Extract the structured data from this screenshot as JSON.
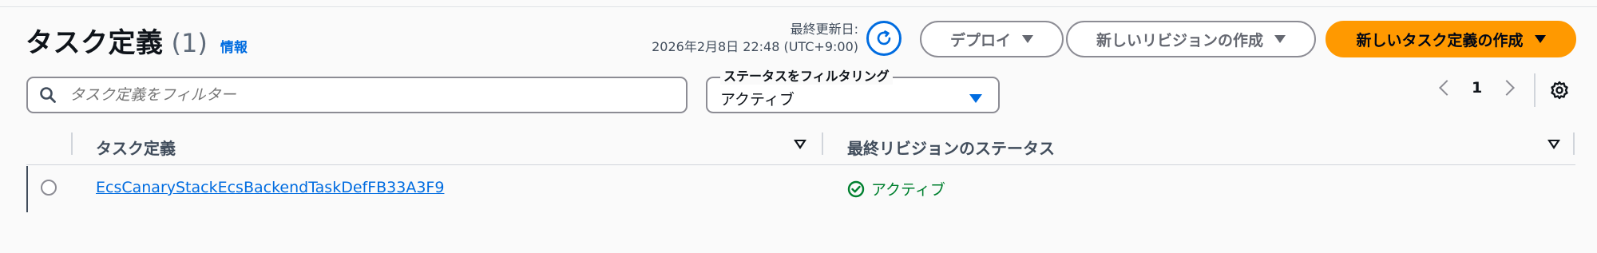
{
  "header": {
    "title": "タスク定義",
    "count": "(1)",
    "info_link": "情報",
    "last_updated_label": "最終更新日:",
    "last_updated_value": "2026年2月8日 22:48 (UTC+9:00)"
  },
  "actions": {
    "deploy_label": "デプロイ",
    "create_revision_label": "新しいリビジョンの作成",
    "create_task_definition_label": "新しいタスク定義の作成"
  },
  "filter": {
    "search_placeholder": "タスク定義をフィルター",
    "status_filter_label": "ステータスをフィルタリング",
    "status_filter_value": "アクティブ"
  },
  "pagination": {
    "current_page": "1"
  },
  "table": {
    "columns": [
      "タスク定義",
      "最終リビジョンのステータス"
    ],
    "rows": [
      {
        "task_definition": "EcsCanaryStackEcsBackendTaskDefFB33A3F9",
        "status": "アクティブ"
      }
    ]
  },
  "icons": [
    "refresh-icon",
    "search-icon",
    "chevron-left-icon",
    "chevron-right-icon",
    "settings-icon",
    "sort-icon",
    "check-circle-icon"
  ],
  "colors": {
    "primary_button": "#ff9900",
    "link": "#006ce0",
    "status_active": "#00802f"
  }
}
